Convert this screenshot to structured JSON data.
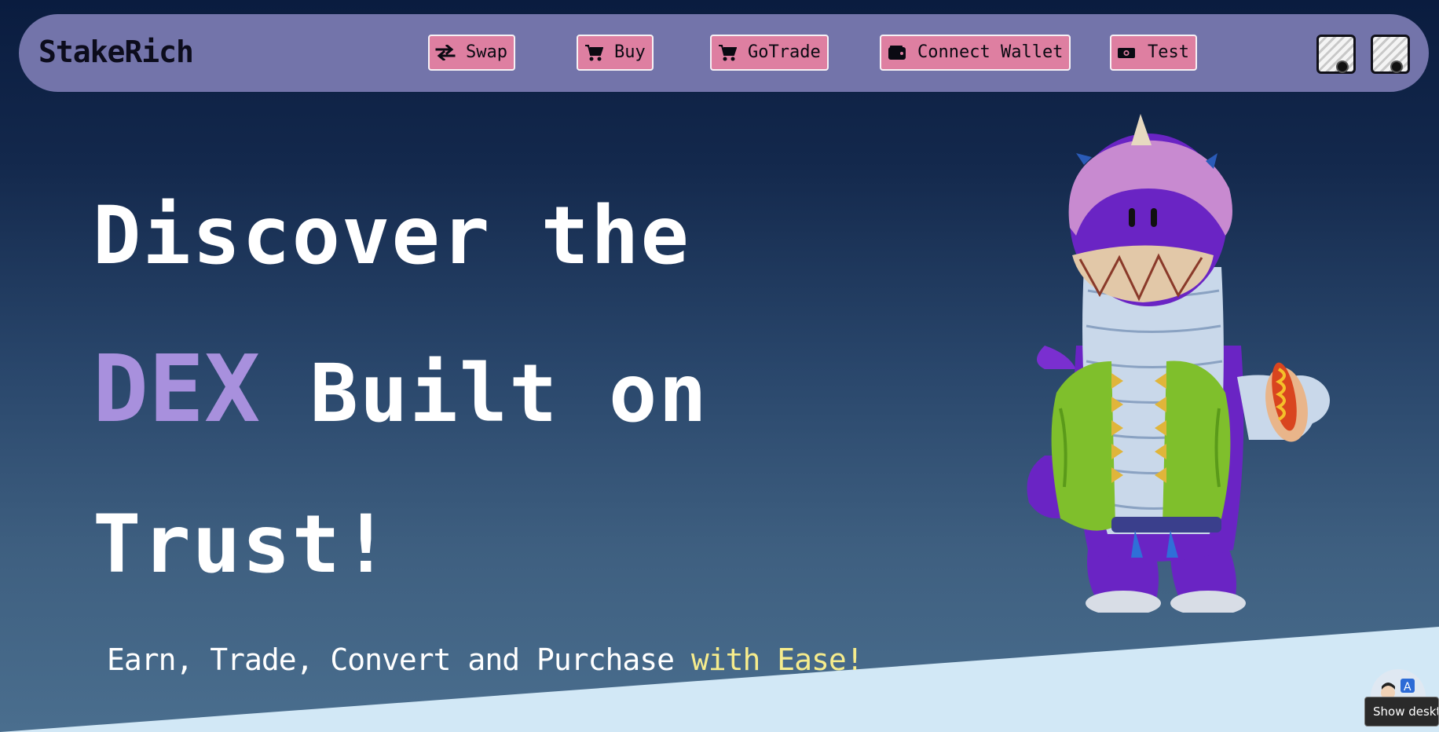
{
  "brand": {
    "name": "StakeRich"
  },
  "nav": {
    "items": [
      {
        "label": "Swap",
        "icon": "swap-arrows-icon"
      },
      {
        "label": "Buy",
        "icon": "cart-icon"
      },
      {
        "label": "GoTrade",
        "icon": "cart-icon"
      },
      {
        "label": "Connect Wallet",
        "icon": "wallet-icon"
      },
      {
        "label": "Test",
        "icon": "money-icon"
      }
    ],
    "icon_buttons": [
      {
        "icon": "toggle-icon"
      },
      {
        "icon": "toggle-icon"
      }
    ]
  },
  "hero": {
    "line1": "Discover the",
    "line2_accent": "DEX",
    "line2_rest": " Built on",
    "line3": "Trust!",
    "tagline_main": "Earn, Trade, Convert and Purchase ",
    "tagline_highlight": "with Ease!"
  },
  "corner": {
    "tooltip": "Show desktop",
    "avatar_icon": "user-avatar-icon"
  },
  "colors": {
    "navbar": "#7374aa",
    "nav_button": "#de7fa1",
    "accent_purple": "#a890dd",
    "highlight_yellow": "#f6ec8c",
    "bottom_panel": "#d2e8f6"
  }
}
